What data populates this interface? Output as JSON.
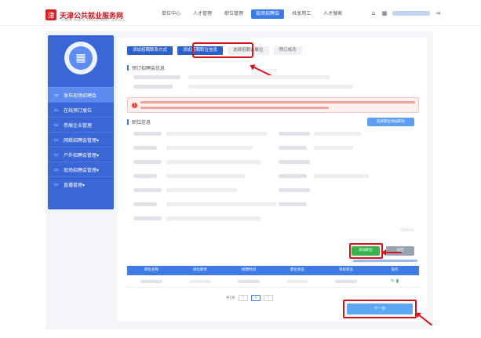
{
  "header": {
    "logo_mark": "津",
    "site_title": "天津公共就业服务网",
    "site_subtitle": "TIANJIN PUBLIC EMPLOYMENT SERVICE",
    "nav": [
      "单位中心",
      "人才管理",
      "职位管理",
      "现场招聘会",
      "共享用工",
      "人才搜索"
    ],
    "active_nav_index": 3,
    "home_icon": "⌂",
    "building_icon": "▦",
    "logout_icon": "⇥"
  },
  "sidebar": {
    "avatar_icon": "▦",
    "items": [
      {
        "icon": "▭",
        "label": "发布现场招聘会"
      },
      {
        "icon": "▭",
        "label": "在线预订展位"
      },
      {
        "icon": "▭",
        "label": "参展企业管理"
      },
      {
        "icon": "▭",
        "label": "网络招聘会管理▾"
      },
      {
        "icon": "▭",
        "label": "户外招聘会管理▾"
      },
      {
        "icon": "▭",
        "label": "现场招聘会管理▾"
      },
      {
        "icon": "▭",
        "label": "直播管理▾"
      }
    ],
    "active_index": 0
  },
  "steps": [
    "添加招聘联系方式",
    "添加招聘职位信息",
    "选择招聘会展位",
    "预订成功"
  ],
  "current_step": 1,
  "sections": {
    "contact": "预订招聘会信息",
    "jobs": "职位信息"
  },
  "warning_icon": "!",
  "buttons": {
    "select_jobs": "选择职位添加职位",
    "add_job": "添加职位",
    "back": "返回",
    "next": "下一步"
  },
  "table": {
    "headers": [
      "职位名称",
      "岗位职责",
      "招聘时间",
      "职位状态",
      "审核状态",
      "操作"
    ],
    "edit_icon": "✎",
    "delete_icon": "▮"
  },
  "pager": {
    "total": "共1条",
    "prev": "‹",
    "page": "1",
    "next": "›"
  }
}
